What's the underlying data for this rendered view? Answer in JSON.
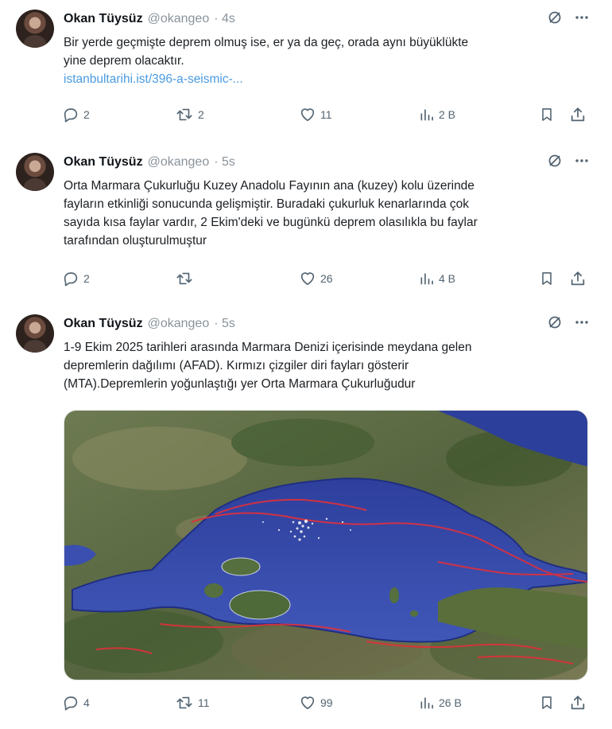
{
  "tweets": [
    {
      "name": "Okan Tüysüz",
      "handle": "@okangeo",
      "time": "· 4s",
      "lines": [
        "Bir yerde geçmişte deprem olmuş ise, er ya da geç, orada aynı büyüklükte",
        "yine deprem olacaktır."
      ],
      "link": "istanbultarihi.ist/396-a-seismic-...",
      "replies": "2",
      "retweets": "2",
      "likes": "11",
      "views": "2 B"
    },
    {
      "name": "Okan Tüysüz",
      "handle": "@okangeo",
      "time": "· 5s",
      "lines": [
        "Orta Marmara Çukurluğu Kuzey Anadolu Fayının ana (kuzey) kolu üzerinde",
        "fayların etkinliği sonucunda gelişmiştir. Buradaki çukurluk kenarlarında çok",
        "sayıda kısa faylar vardır, 2 Ekim'deki ve bugünkü deprem olasılıkla bu faylar",
        "tarafından oluşturulmuştur"
      ],
      "replies": "2",
      "retweets": "",
      "likes": "26",
      "views": "4 B"
    },
    {
      "name": "Okan Tüysüz",
      "handle": "@okangeo",
      "time": "· 5s",
      "lines": [
        "1-9 Ekim 2025 tarihleri arasında Marmara Denizi içerisinde meydana gelen",
        "depremlerin dağılımı (AFAD). Kırmızı çizgiler diri fayları gösterir",
        "(MTA).Depremlerin yoğunlaştığı yer Orta Marmara Çukurluğudur"
      ],
      "replies": "4",
      "retweets": "11",
      "likes": "99",
      "views": "26 B"
    }
  ],
  "colors": {
    "text": "#0f1419",
    "muted": "#536471",
    "link": "#4a9be0",
    "sea": "#3a4fb0",
    "fault": "#e0303a"
  },
  "icons": [
    "grok-icon",
    "more-icon",
    "reply-icon",
    "retweet-icon",
    "like-icon",
    "views-icon",
    "bookmark-icon",
    "share-icon"
  ]
}
